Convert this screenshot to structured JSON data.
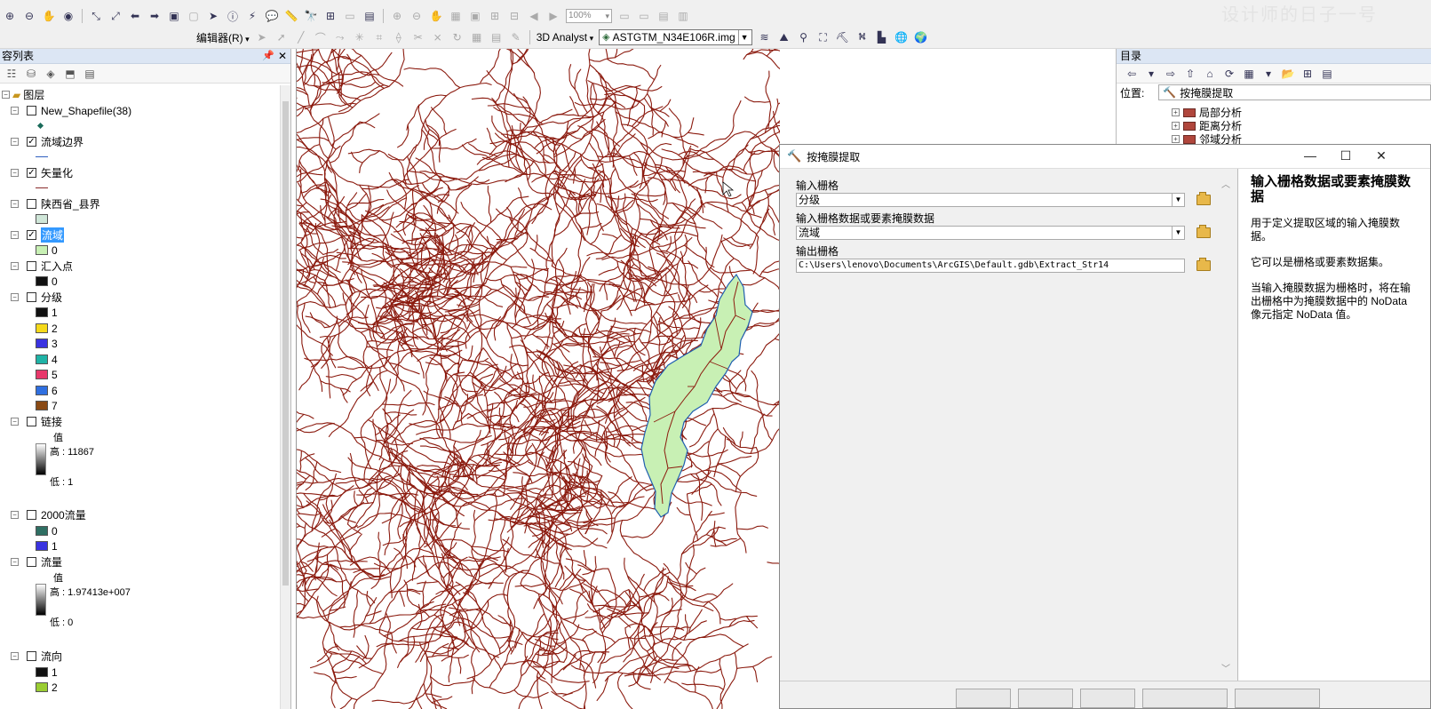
{
  "toolbar": {
    "zoom_value": "100%",
    "editor_label": "编辑器(R)",
    "analyst_label": "3D Analyst",
    "layer_select_value": "ASTGTM_N34E106R.img",
    "watermark": "设计师的日子一号"
  },
  "toc": {
    "title": "容列表",
    "root_label": "图层",
    "layers": [
      {
        "name": "New_Shapefile(38)",
        "checked": false
      },
      {
        "name": "流域边界",
        "checked": true
      },
      {
        "name": "矢量化",
        "checked": true
      },
      {
        "name": "陕西省_县界",
        "checked": false
      },
      {
        "name": "流域",
        "checked": true,
        "selected": true,
        "sym_label": "0"
      },
      {
        "name": "汇入点",
        "checked": false,
        "sym_label": "0"
      },
      {
        "name": "分级",
        "checked": false
      },
      {
        "name": "链接",
        "checked": false
      },
      {
        "name": "2000流量",
        "checked": false
      },
      {
        "name": "流量",
        "checked": false
      },
      {
        "name": "流向",
        "checked": false
      }
    ],
    "fenji_classes": [
      {
        "label": "1",
        "color": "#111111"
      },
      {
        "label": "2",
        "color": "#f5d91a"
      },
      {
        "label": "3",
        "color": "#3a33e0"
      },
      {
        "label": "4",
        "color": "#1fb3a6"
      },
      {
        "label": "5",
        "color": "#e8386b"
      },
      {
        "label": "6",
        "color": "#2f6fe0"
      },
      {
        "label": "7",
        "color": "#8a4a14"
      }
    ],
    "lianjie": {
      "value_label": "值",
      "high": "高 : 11867",
      "low": "低 : 1"
    },
    "flow2000_classes": [
      {
        "label": "0",
        "color": "#2f6f63"
      },
      {
        "label": "1",
        "color": "#3a33e0"
      }
    ],
    "liuliang": {
      "value_label": "值",
      "high": "高 : 1.97413e+007",
      "low": "低 : 0"
    },
    "liuxiang_classes": [
      {
        "label": "1",
        "color": "#111111"
      },
      {
        "label": "2",
        "color": "#9acd32"
      }
    ],
    "colors": {
      "boundary_line": "#3060c0",
      "vector_line": "#8a2b2b",
      "county_fill": "#cfe6d8",
      "watershed_fill": "#c8f0b4",
      "inflow_fill": "#111111"
    }
  },
  "catalog": {
    "title": "目录",
    "location_label": "位置:",
    "location_value": "按掩膜提取",
    "tree_items": [
      "局部分析",
      "距离分析",
      "邻域分析"
    ]
  },
  "dialog": {
    "title": "按掩膜提取",
    "fields": [
      {
        "label": "输入栅格",
        "value": "分级",
        "type": "dropdown"
      },
      {
        "label": "输入栅格数据或要素掩膜数据",
        "value": "流域",
        "type": "dropdown"
      },
      {
        "label": "输出栅格",
        "value": "C:\\Users\\lenovo\\Documents\\ArcGIS\\Default.gdb\\Extract_Str14",
        "type": "text"
      }
    ],
    "help": {
      "title": "输入栅格数据或要素掩膜数据",
      "paragraphs": [
        "用于定义提取区域的输入掩膜数据。",
        "它可以是栅格或要素数据集。",
        "当输入掩膜数据为栅格时，将在输出栅格中为掩膜数据中的 NoData 像元指定 NoData 值。"
      ]
    }
  },
  "map": {
    "stream_color": "#8b1a0e",
    "watershed_fill": "#c8f0b4",
    "watershed_outline": "#1f5fb0"
  }
}
